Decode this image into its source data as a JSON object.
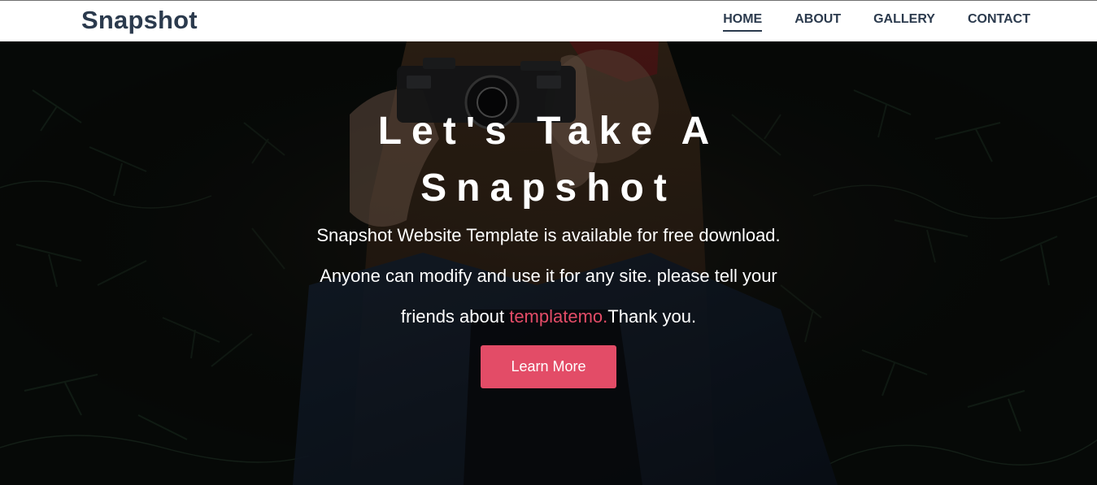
{
  "navbar": {
    "brand": "Snapshot",
    "links": [
      {
        "label": "HOME",
        "active": true
      },
      {
        "label": "ABOUT",
        "active": false
      },
      {
        "label": "GALLERY",
        "active": false
      },
      {
        "label": "CONTACT",
        "active": false
      }
    ]
  },
  "hero": {
    "title_line1": "Let's Take A",
    "title_line2": "Snapshot",
    "text_line1": "Snapshot Website Template is available for free download.",
    "text_line2": "Anyone can modify and use it for any site. please tell your",
    "text_line3_before": "friends about ",
    "text_line3_link": "templatemo.",
    "text_line3_after": "Thank you.",
    "button_label": "Learn More"
  },
  "colors": {
    "accent": "#e34c67",
    "nav_text": "#2b3a4d",
    "navbar_bg": "#ffffff"
  }
}
